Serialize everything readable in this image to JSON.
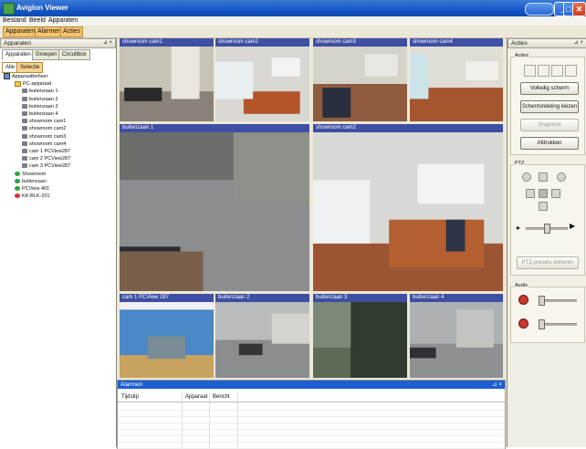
{
  "window": {
    "title": "Aviglon Viewer"
  },
  "menu": [
    "Bestand",
    "Beeld",
    "Apparaten"
  ],
  "toolbar": [
    "Apparaten",
    "Alarmen",
    "Acties"
  ],
  "left_pane": {
    "title": "Apparaten",
    "tabs": [
      "Apparaten",
      "Groepen",
      "Circuitbox"
    ],
    "subtabs": [
      "Alle",
      "Selectie"
    ],
    "tree": [
      {
        "label": "Apparaatbeheer",
        "icon": "pc-icon",
        "level": 0
      },
      {
        "label": "PC-apparaat",
        "icon": "folder-icon",
        "level": 1
      },
      {
        "label": "buitenzaan 1",
        "icon": "camera-icon",
        "level": 2
      },
      {
        "label": "buitenzaan 2",
        "icon": "camera-icon",
        "level": 2
      },
      {
        "label": "buitenzaan 3",
        "icon": "camera-icon",
        "level": 2
      },
      {
        "label": "buitenzaan 4",
        "icon": "camera-icon",
        "level": 2
      },
      {
        "label": "showroom cam1",
        "icon": "camera-icon",
        "level": 2
      },
      {
        "label": "showroom cam2",
        "icon": "camera-icon",
        "level": 2
      },
      {
        "label": "showroom cam3",
        "icon": "camera-icon",
        "level": 2
      },
      {
        "label": "showroom cam4",
        "icon": "camera-icon",
        "level": 2
      },
      {
        "label": "cam 1 PCView287",
        "icon": "camera-icon",
        "level": 2
      },
      {
        "label": "cam 2 PCView287",
        "icon": "camera-icon",
        "level": 2
      },
      {
        "label": "cam 3 PCView287",
        "icon": "camera-icon",
        "level": 2
      },
      {
        "label": "Showroom",
        "icon": "green-icon",
        "level": 1
      },
      {
        "label": "buitenzaan",
        "icon": "green-icon",
        "level": 1
      },
      {
        "label": "PCView 401",
        "icon": "green-icon",
        "level": 1
      },
      {
        "label": "KK-BLK-201",
        "icon": "red-icon",
        "level": 1
      }
    ]
  },
  "grid": {
    "cells": [
      {
        "caption": "showroom cam1",
        "scene": "office-desk"
      },
      {
        "caption": "showroom cam2",
        "scene": "meeting-room"
      },
      {
        "caption": "showroom cam3",
        "scene": "meeting-room2"
      },
      {
        "caption": "showroom cam4",
        "scene": "meeting-room3"
      },
      {
        "caption": "buitenzaan 1",
        "scene": "parking-lot"
      },
      {
        "caption": "showroom cam2",
        "scene": "conference-room"
      },
      {
        "caption": "cam 1 PCView 287",
        "scene": "blue-room"
      },
      {
        "caption": "buitenzaan 2",
        "scene": "outside-car"
      },
      {
        "caption": "buitenzaan 3",
        "scene": "tree"
      },
      {
        "caption": "buitenzaan 4",
        "scene": "outside-street"
      }
    ]
  },
  "log": {
    "title": "Alarmen",
    "columns": [
      "Tijdstip",
      "Apparaat",
      "Bericht"
    ]
  },
  "right_pane": {
    "title": "Acties",
    "group_actions": "Acties",
    "buttons": [
      "Volledig scherm",
      "Schermindeling kiezen",
      "Snapshot",
      "Afdrukken"
    ],
    "group_ptz": "PTZ",
    "ptz_preset_label": "PTZ-presets beheren",
    "group_audio": "Audio"
  },
  "colors": {
    "titlebar": "#1456c8",
    "caption_bar": "#3f4fa3",
    "toolbar_button": "#f7c46d"
  }
}
